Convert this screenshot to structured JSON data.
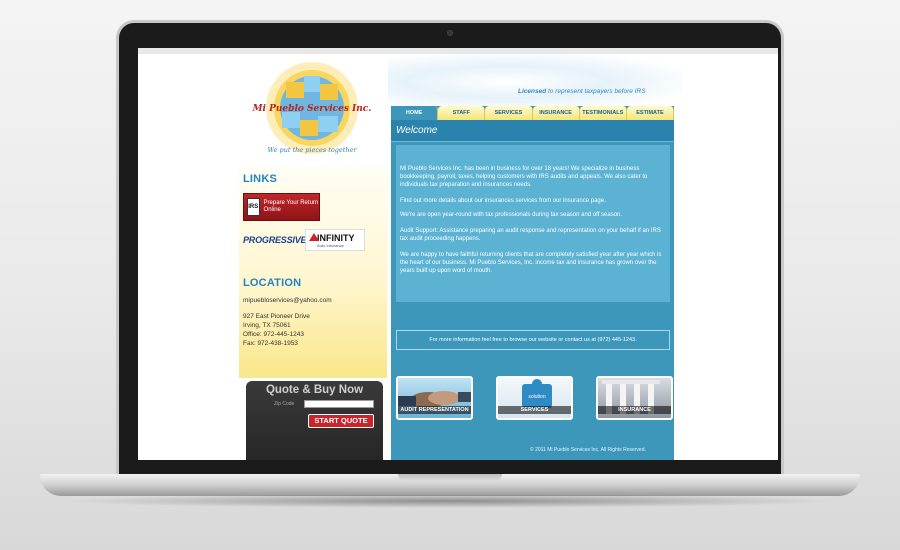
{
  "site": {
    "logo_text": "Mi Pueblo Services Inc.",
    "tagline": "We put the pieces together",
    "licensed_prefix": "Licensed",
    "licensed_rest": " to represent taxpayers before IRS"
  },
  "nav": {
    "tabs": [
      "HOME",
      "STAFF",
      "SERVICES",
      "INSURANCE",
      "TESTIMONIALS",
      "ESTIMATE"
    ],
    "active": "HOME"
  },
  "sidebar": {
    "links_heading": "LINKS",
    "irs_logo": "IRS",
    "irs_button": "Prepare Your Return Online",
    "progressive": "PROGRESSIVE",
    "infinity": "INFINITY",
    "infinity_sub": "Auto Insurance",
    "location_heading": "LOCATION",
    "email": "mipuebloservices@yahoo.com",
    "address1": "927 East Pioneer Drive",
    "address2": "Irving, TX 75061",
    "office": "Office: 972-445-1243",
    "fax": "Fax: 972-438-1953"
  },
  "quote": {
    "title": "Quote & Buy Now",
    "zip_label": "Zip Code",
    "zip_value": "",
    "button": "START QUOTE"
  },
  "main": {
    "welcome": "Welcome",
    "p1": "Mi Pueblo Services Inc. has been in business for over 18 years! We specialize in business bookkeeping, payroll, taxes, helping customers with IRS audits and appeals. We also cater to individuals tax preparation and insurances needs.",
    "p2": "Find out more details about our insurances services from our insurance page.",
    "p3": "We're are open year-round with tax professionals during tax season and off season.",
    "p4": "Audit Support: Assistance preparing an audit response and representation on your behalf if an IRS tax audit proceeding happens.",
    "p5": "We are happy to have faithful returning clients that are completely satisfied year after year which is the heart of our business. Mi Pueblo Services, Inc. income tax and insurance has grown over the years built up upon word of mouth.",
    "info": "For more information feel free to browse our website or contact us at (972) 445-1243.",
    "thumbs": [
      "AUDIT REPRESENTATION",
      "SERVICES",
      "INSURANCE"
    ],
    "thumb_overlay": "solution",
    "copyright": "© 2011 Mi Pueblo Services Inc. All Rights Reserved."
  },
  "colors": {
    "panel": "#3c97bb",
    "accent_blue": "#1f84c2",
    "tab_yellow": "#f4e57a",
    "quote_red": "#c8242a"
  }
}
